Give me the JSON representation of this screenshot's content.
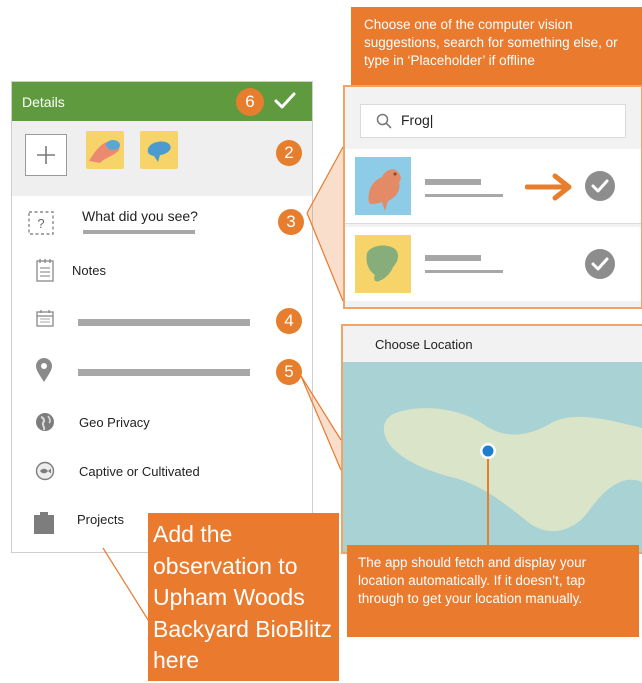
{
  "colors": {
    "accent_orange": "#e97a2e",
    "header_green": "#5f9a3e",
    "map_water": "#a9d2d4",
    "map_land": "#d9e4c8",
    "pin_blue": "#1e7fd0"
  },
  "top_callout": {
    "text": "Choose one of the computer vision suggestions, search for something else, or type in ‘Placeholder’ if offline"
  },
  "observation_form": {
    "header": {
      "title": "Details",
      "save_icon": "checkmark-icon"
    },
    "badges": {
      "b2": "2",
      "b3": "3",
      "b4": "4",
      "b5": "5",
      "b6": "6"
    },
    "photos": {
      "add_icon": "plus-icon"
    },
    "rows": {
      "species_prompt": "What did you see?",
      "notes": "Notes",
      "geo_privacy": "Geo Privacy",
      "captive": "Captive or Cultivated",
      "projects": "Projects"
    }
  },
  "species_search": {
    "query": "Frog|",
    "search_icon": "search-icon"
  },
  "location_panel": {
    "title": "Choose Location",
    "callout": "The app should fetch and display your location automatically. If it doesn’t, tap through to get your location manually."
  },
  "projects_callout": {
    "text": "Add the observation to Upham Woods Backyard BioBlitz here"
  }
}
